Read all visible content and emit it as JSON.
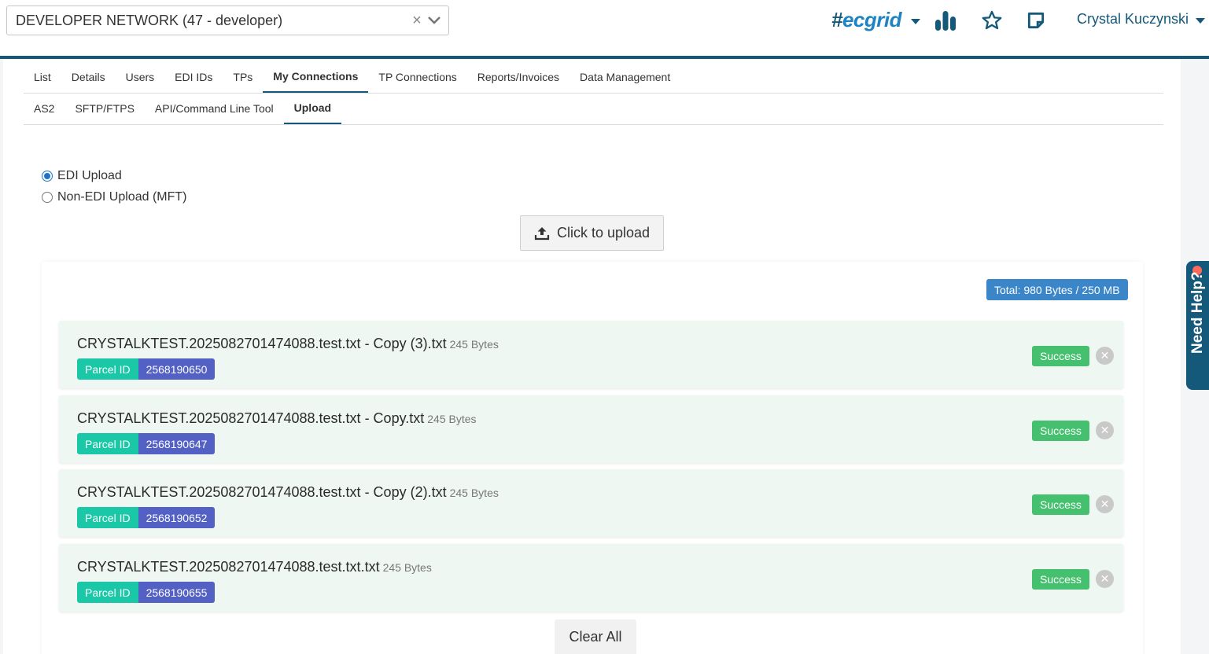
{
  "header": {
    "network": "DEVELOPER NETWORK (47 - developer)",
    "brand": "ecgrid",
    "brand_hash": "#",
    "user": "Crystal Kuczynski",
    "icons": [
      "chart-icon",
      "star-icon",
      "note-icon"
    ]
  },
  "tabs_primary": [
    {
      "label": "List"
    },
    {
      "label": "Details"
    },
    {
      "label": "Users"
    },
    {
      "label": "EDI IDs"
    },
    {
      "label": "TPs"
    },
    {
      "label": "My Connections",
      "active": true
    },
    {
      "label": "TP Connections"
    },
    {
      "label": "Reports/Invoices"
    },
    {
      "label": "Data Management"
    }
  ],
  "tabs_secondary": [
    {
      "label": "AS2"
    },
    {
      "label": "SFTP/FTPS"
    },
    {
      "label": "API/Command Line Tool"
    },
    {
      "label": "Upload",
      "active": true
    }
  ],
  "upload": {
    "options": [
      {
        "label": "EDI Upload",
        "checked": true
      },
      {
        "label": "Non-EDI Upload (MFT)",
        "checked": false
      }
    ],
    "button": "Click to upload",
    "total": "Total: 980 Bytes / 250 MB",
    "clear": "Clear All"
  },
  "files": [
    {
      "name": "CRYSTALKTEST.2025082701474088.test.txt - Copy (3).txt",
      "size": "245 Bytes",
      "parcel_label": "Parcel ID",
      "parcel_id": "2568190650",
      "status": "Success"
    },
    {
      "name": "CRYSTALKTEST.2025082701474088.test.txt - Copy.txt",
      "size": "245 Bytes",
      "parcel_label": "Parcel ID",
      "parcel_id": "2568190647",
      "status": "Success"
    },
    {
      "name": "CRYSTALKTEST.2025082701474088.test.txt - Copy (2).txt",
      "size": "245 Bytes",
      "parcel_label": "Parcel ID",
      "parcel_id": "2568190652",
      "status": "Success"
    },
    {
      "name": "CRYSTALKTEST.2025082701474088.test.txt.txt",
      "size": "245 Bytes",
      "parcel_label": "Parcel ID",
      "parcel_id": "2568190655",
      "status": "Success"
    }
  ],
  "help": {
    "label": "Need Help?"
  },
  "colors": {
    "primary": "#14587a",
    "accent": "#1d83c2",
    "success": "#45c06e",
    "parcel_label": "#1ac8a8",
    "parcel_id": "#5361c5",
    "total_badge": "#3a86c9"
  }
}
